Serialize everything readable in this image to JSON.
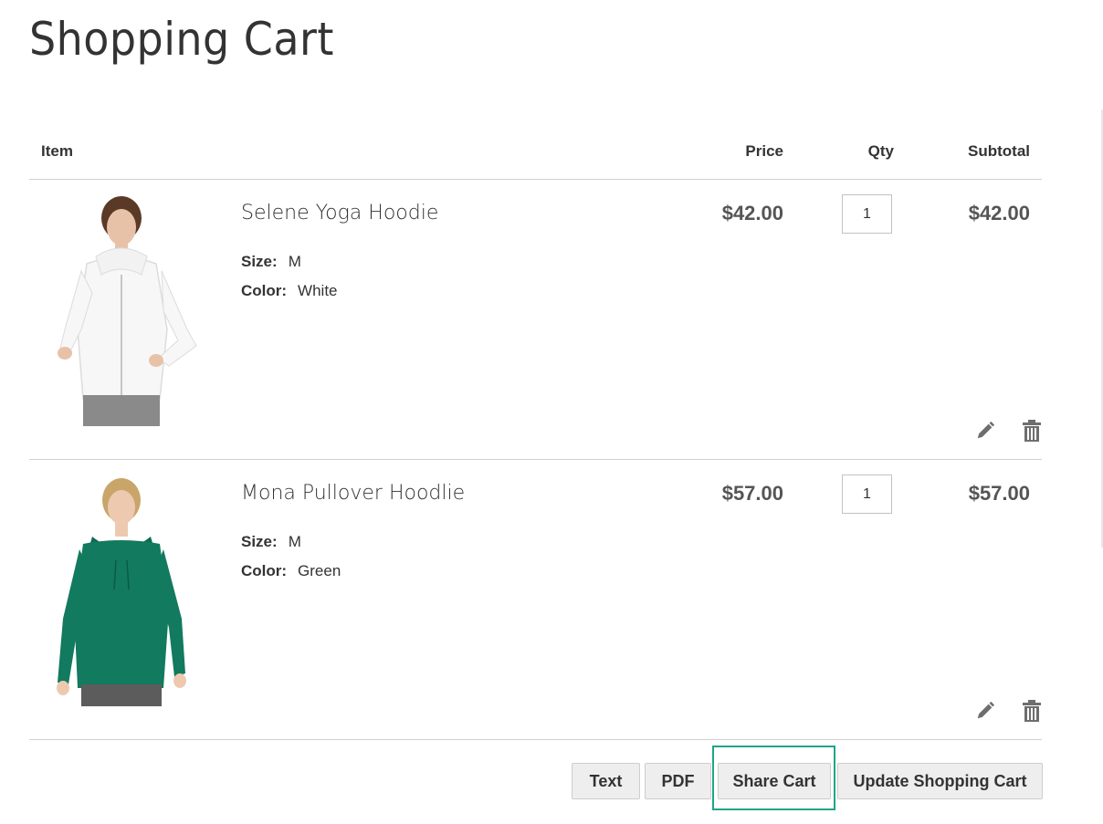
{
  "page": {
    "title": "Shopping Cart"
  },
  "table": {
    "headers": {
      "item": "Item",
      "price": "Price",
      "qty": "Qty",
      "subtotal": "Subtotal"
    }
  },
  "items": [
    {
      "name": "Selene Yoga Hoodie",
      "size_label": "Size:",
      "size_value": "M",
      "color_label": "Color:",
      "color_value": "White",
      "price": "$42.00",
      "qty": "1",
      "subtotal": "$42.00",
      "image_colors": {
        "top": "#f7f7f7",
        "pants": "#8a8a8a",
        "skin": "#e8c2a8",
        "hair": "#5a3a26"
      }
    },
    {
      "name": "Mona Pullover Hoodlie",
      "size_label": "Size:",
      "size_value": "M",
      "color_label": "Color:",
      "color_value": "Green",
      "price": "$57.00",
      "qty": "1",
      "subtotal": "$57.00",
      "image_colors": {
        "top": "#127a5e",
        "pants": "#5c5c5c",
        "skin": "#edc9b0",
        "hair": "#c9a56a"
      }
    }
  ],
  "actions": {
    "text_label": "Text",
    "pdf_label": "PDF",
    "share_label": "Share Cart",
    "update_label": "Update Shopping Cart"
  },
  "icons": {
    "edit": "pencil-icon",
    "delete": "trash-icon"
  },
  "colors": {
    "highlight": "#1fa58a",
    "button_bg": "#eeeeee",
    "divider": "#d1d1d1"
  }
}
